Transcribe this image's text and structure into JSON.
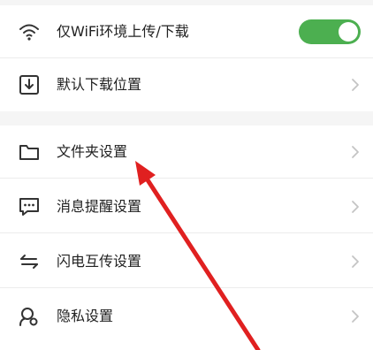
{
  "settings": {
    "group1": [
      {
        "label": "仅WiFi环境上传/下载",
        "icon": "wifi-icon",
        "control": "toggle",
        "toggle_on": true
      },
      {
        "label": "默认下载位置",
        "icon": "download-icon",
        "control": "chevron"
      }
    ],
    "group2": [
      {
        "label": "文件夹设置",
        "icon": "folder-icon",
        "control": "chevron"
      },
      {
        "label": "消息提醒设置",
        "icon": "message-icon",
        "control": "chevron"
      },
      {
        "label": "闪电互传设置",
        "icon": "transfer-icon",
        "control": "chevron"
      },
      {
        "label": "隐私设置",
        "icon": "privacy-icon",
        "control": "chevron"
      }
    ]
  },
  "colors": {
    "toggle_on": "#4caf50",
    "annotation_arrow": "#e02020",
    "text": "#222222",
    "chevron": "#c4c4c4",
    "background": "#f5f5f5"
  }
}
